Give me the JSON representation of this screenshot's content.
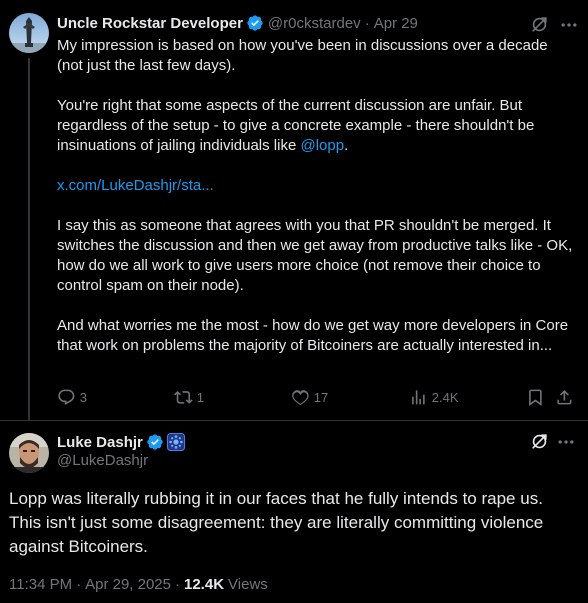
{
  "reply_tweet": {
    "author_name": "Uncle Rockstar Developer",
    "author_handle": "@r0ckstardev",
    "separator": "·",
    "date": "Apr 29",
    "paragraph_1": "My impression is based on how you've been in discussions over a decade (not just the last few days).",
    "paragraph_2_text": "You're right that some aspects of the current discussion are unfair. But regardless of the setup - to give a concrete example - there shouldn't be insinuations of jailing individuals like ",
    "paragraph_2_mention": "@lopp",
    "paragraph_2_end": ".",
    "link": "x.com/LukeDashjr/sta...",
    "paragraph_3": "I say this as someone that agrees with you that PR shouldn't be merged. It switches the discussion and then we get away from productive talks like - OK, how do we all work to give users more choice (not remove their choice to control spam on their node).",
    "paragraph_4": "And what worries me the most - how do we get way more developers in Core that work on problems the majority of Bitcoiners are actually interested in...",
    "actions": {
      "replies": "3",
      "reposts": "1",
      "likes": "17",
      "views": "2.4K"
    }
  },
  "main_tweet": {
    "author_name": "Luke Dashjr",
    "author_handle": "@LukeDashjr",
    "text": "Lopp was literally rubbing it in our faces that he fully intends to rape us. This isn't just some disagreement: they are literally committing violence against Bitcoiners.",
    "time": "11:34 PM",
    "separator_1": "·",
    "date": "Apr 29, 2025",
    "separator_2": "·",
    "views_count": "12.4K",
    "views_label": "Views"
  },
  "icons": {
    "verified": "verified-badge-icon",
    "affiliate": "affiliate-badge-icon",
    "grok": "grok-icon",
    "more": "more-icon",
    "reply": "reply-icon",
    "repost": "repost-icon",
    "like": "like-icon",
    "views": "views-icon",
    "bookmark": "bookmark-icon",
    "share": "share-icon"
  },
  "colors": {
    "background": "#000000",
    "text": "#e7e9ea",
    "muted": "#71767b",
    "link": "#1d9bf0",
    "verified": "#1d9bf0",
    "divider": "#2f3336"
  }
}
